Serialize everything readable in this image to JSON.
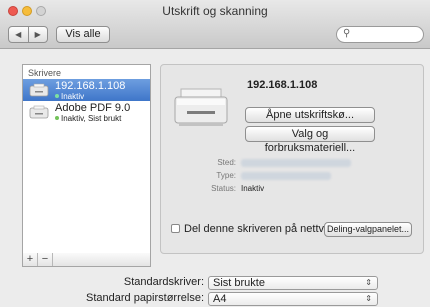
{
  "window": {
    "title": "Utskrift og skanning"
  },
  "toolbar": {
    "back_glyph": "◀",
    "forward_glyph": "▶",
    "show_all": "Vis alle",
    "search_placeholder": ""
  },
  "printers": {
    "header": "Skrivere",
    "items": [
      {
        "name": "192.168.1.108",
        "status": "Inaktiv",
        "selected": true
      },
      {
        "name": "Adobe PDF 9.0",
        "status": "Inaktiv, Sist brukt",
        "selected": false
      }
    ],
    "add_label": "+",
    "remove_label": "−"
  },
  "detail": {
    "title": "192.168.1.108",
    "open_queue": "Åpne utskriftskø...",
    "options_supplies": "Valg og forbruksmateriell...",
    "location_label": "Sted:",
    "type_label": "Type:",
    "status_label": "Status:",
    "status_value": "Inaktiv",
    "share_label": "Del denne skriveren på nettverket",
    "sharing_prefs": "Deling-valgpanelet..."
  },
  "defaults": {
    "default_printer_label": "Standardskriver:",
    "default_printer_value": "Sist brukte",
    "paper_size_label": "Standard papirstørrelse:",
    "paper_size_value": "A4"
  },
  "icons": {
    "search": "magnifier-icon",
    "printer": "printer-icon",
    "status_dot": "#73c35a",
    "selection": "#3f76c9"
  }
}
